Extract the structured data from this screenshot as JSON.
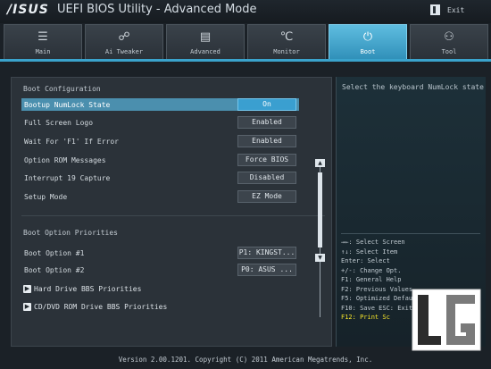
{
  "header": {
    "brand": "/ISUS",
    "title": "UEFI BIOS Utility - Advanced Mode",
    "exit_label": "Exit"
  },
  "tabs": [
    {
      "label": "Main",
      "icon": "list-icon",
      "glyph": "☰"
    },
    {
      "label": "Ai Tweaker",
      "icon": "gauge-icon",
      "glyph": "☍"
    },
    {
      "label": "Advanced",
      "icon": "chip-icon",
      "glyph": "▤"
    },
    {
      "label": "Monitor",
      "icon": "thermometer-icon",
      "glyph": "℃"
    },
    {
      "label": "Boot",
      "icon": "power-icon",
      "glyph": "⏻"
    },
    {
      "label": "Tool",
      "icon": "printer-icon",
      "glyph": "⚇"
    }
  ],
  "active_tab": "Boot",
  "boot_config": {
    "title": "Boot Configuration",
    "rows": [
      {
        "label": "Bootup NumLock State",
        "value": "On"
      },
      {
        "label": "Full Screen Logo",
        "value": "Enabled"
      },
      {
        "label": "Wait For 'F1' If Error",
        "value": "Enabled"
      },
      {
        "label": "Option ROM Messages",
        "value": "Force BIOS"
      },
      {
        "label": "Interrupt 19 Capture",
        "value": "Disabled"
      },
      {
        "label": "Setup Mode",
        "value": "EZ Mode"
      }
    ]
  },
  "boot_priorities": {
    "title": "Boot Option Priorities",
    "rows": [
      {
        "label": "Boot Option #1",
        "value": "P1: KINGST..."
      },
      {
        "label": "Boot Option #2",
        "value": "P0: ASUS   ..."
      }
    ],
    "submenus": [
      {
        "label": "Hard Drive BBS Priorities"
      },
      {
        "label": "CD/DVD ROM Drive BBS Priorities"
      }
    ]
  },
  "help": {
    "text": "Select the keyboard NumLock state",
    "keys": [
      "→←: Select Screen",
      "↑↓: Select Item",
      "Enter: Select",
      "+/-: Change Opt.",
      "F1: General Help",
      "F2: Previous Values",
      "F5: Optimized Defaults",
      "F10: Save  ESC: Exit",
      "F12: Print Sc"
    ]
  },
  "footer": {
    "text": "Version 2.00.1201. Copyright (C) 2011 American Megatrends, Inc."
  },
  "colors": {
    "accent": "#3aa3cc",
    "highlight_row": "#4b8fae",
    "hot_key": "#f3e32b"
  }
}
